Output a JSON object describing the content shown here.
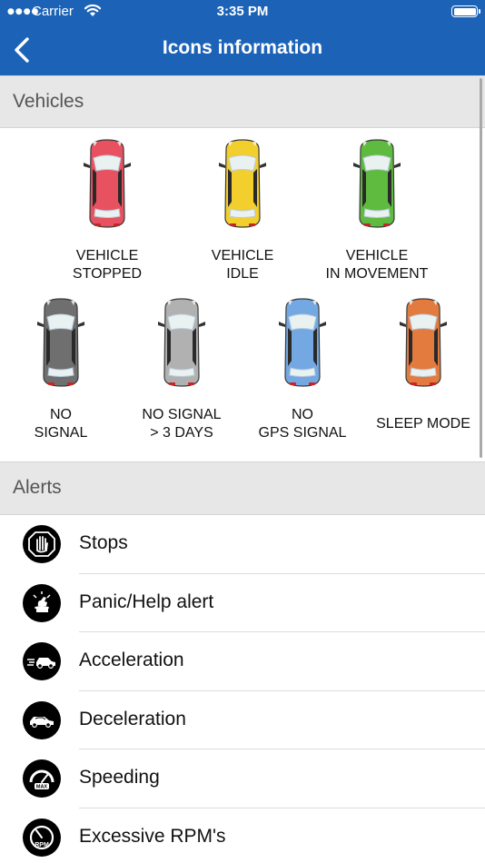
{
  "status_bar": {
    "carrier": "Carrier",
    "time": "3:35 PM"
  },
  "nav": {
    "title": "Icons information"
  },
  "vehicles_section": {
    "header": "Vehicles",
    "row1": [
      {
        "label": "VEHICLE\nSTOPPED",
        "color": "#e8515f"
      },
      {
        "label": "VEHICLE\nIDLE",
        "color": "#f2cf2c"
      },
      {
        "label": "VEHICLE\nIN MOVEMENT",
        "color": "#5fbb3f"
      }
    ],
    "row2": [
      {
        "label": "NO\nSIGNAL",
        "color": "#6f6f6f"
      },
      {
        "label": "NO SIGNAL\n> 3 DAYS",
        "color": "#b1b1b1"
      },
      {
        "label": "NO\nGPS SIGNAL",
        "color": "#73a8e2"
      },
      {
        "label": "SLEEP MODE",
        "color": "#e47b3e"
      }
    ]
  },
  "alerts_section": {
    "header": "Alerts",
    "items": [
      {
        "label": "Stops",
        "icon": "stop-hand-icon"
      },
      {
        "label": "Panic/Help alert",
        "icon": "panic-button-icon"
      },
      {
        "label": "Acceleration",
        "icon": "acceleration-car-icon"
      },
      {
        "label": "Deceleration",
        "icon": "deceleration-car-icon"
      },
      {
        "label": "Speeding",
        "icon": "speedometer-max-icon"
      },
      {
        "label": "Excessive RPM's",
        "icon": "rpm-gauge-icon"
      }
    ]
  }
}
